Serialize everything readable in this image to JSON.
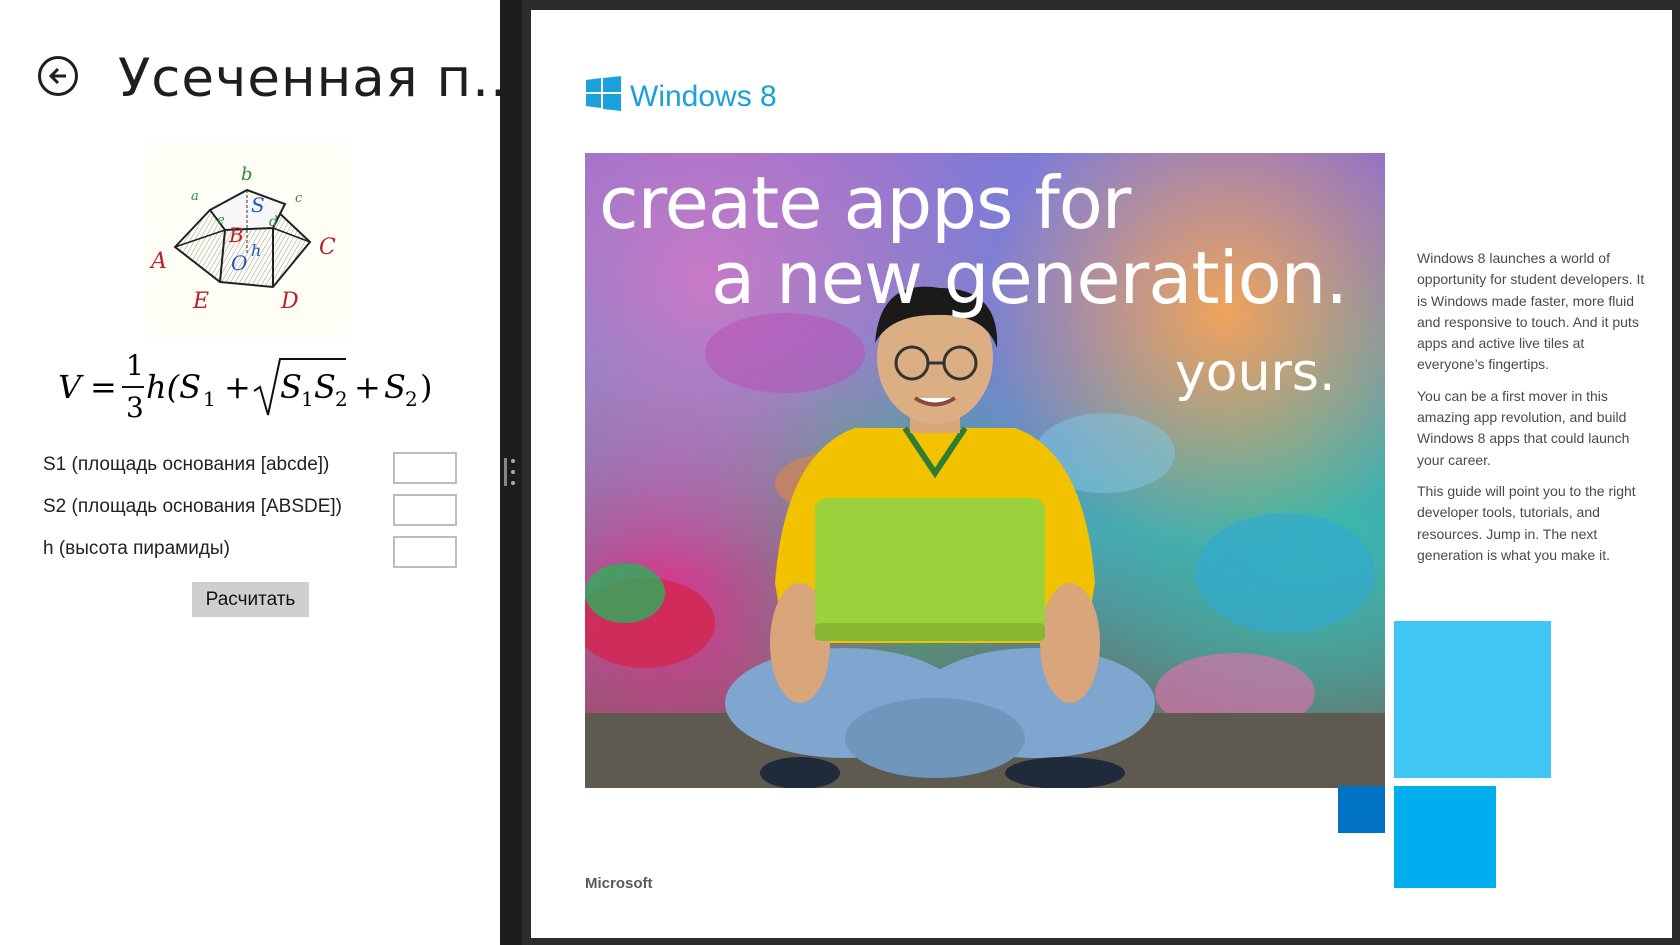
{
  "left_app": {
    "title": "Усеченная п...",
    "figure_labels": {
      "a": "a",
      "b": "b",
      "c": "c",
      "d": "d",
      "e": "e",
      "A": "A",
      "B": "B",
      "C": "C",
      "D": "D",
      "E": "E",
      "S": "S",
      "O": "O",
      "h": "h"
    },
    "formula": {
      "lhs": "V",
      "eq": "=",
      "num": "1",
      "den": "3",
      "body": "h(S",
      "s1_sub": "1",
      "plus1": "+",
      "root_s1": "S",
      "root_s1_sub": "1",
      "root_s2": "S",
      "root_s2_sub": "2",
      "plus2": "+",
      "s2": "S",
      "s2_sub": "2",
      "close": ")"
    },
    "fields": [
      {
        "label": "S1 (площадь основания [abcde])",
        "value": ""
      },
      {
        "label": "S2 (площадь основания [ABSDE])",
        "value": ""
      },
      {
        "label": "h (высота пирамиды)",
        "value": ""
      }
    ],
    "calc_button": "Расчитать"
  },
  "document": {
    "logo_text": "Windows 8",
    "hero": {
      "line1": "create apps for",
      "line2": "a new generation.",
      "line3": "yours."
    },
    "paragraphs": [
      "Windows 8 launches a world of opportunity for student developers. It is Windows made faster, more fluid and responsive to touch. And it puts apps and active live tiles at everyone’s fingertips.",
      "You can be a first mover in this amazing app revolution, and build Windows 8 apps that could launch your career.",
      "This guide will point you to the right developer tools, tutorials, and resources. Jump in. The next generation is what you make it."
    ],
    "footer_brand": "Microsoft"
  },
  "colors": {
    "win_blue": "#1aa1dc",
    "tile_light": "#3fc6f4",
    "tile_mid": "#00aeef",
    "tile_dark": "#0072c6",
    "laptop_green": "#9bd13a",
    "shirt_yellow": "#f2c200"
  }
}
